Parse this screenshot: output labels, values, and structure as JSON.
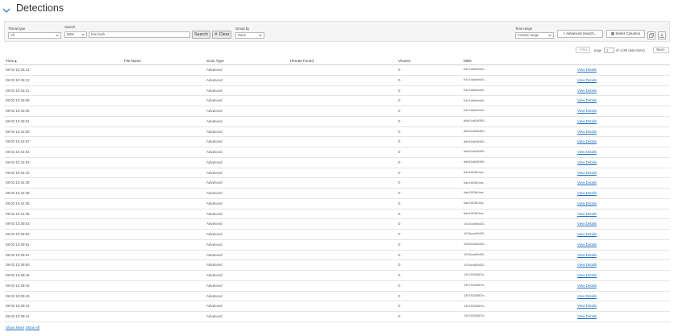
{
  "page": {
    "title": "Detections"
  },
  "filters": {
    "threat_type": {
      "label": "Threat type",
      "value": "All"
    },
    "search": {
      "label": "Search",
      "field": "MD5",
      "value": "has hash",
      "search_button": "Search",
      "clear_button": "Clear"
    },
    "group_by": {
      "label": "Group by",
      "value": "None"
    },
    "time_range": {
      "label": "Time range",
      "value": "Custom range"
    },
    "advanced_button": "Advanced Search...",
    "columns_button": "Select Columns"
  },
  "pagination": {
    "prev": "‹ Prev",
    "page_label": "page",
    "page": "1",
    "of_text": "of 4 (80 detections)",
    "next": "Next ›"
  },
  "table": {
    "headers": {
      "time": "Time",
      "file_name": "File Name",
      "scan_type": "Scan Type",
      "threats_found": "Threats Found",
      "viruses": "Viruses",
      "md5": "MD5"
    },
    "link_text": "View Details",
    "rows": [
      {
        "time": "08-03 10:45:12",
        "scan": "Advanced",
        "viruses": "0",
        "md5": "b3c7c6a6eb64..."
      },
      {
        "time": "08-03 10:45:12",
        "scan": "Advanced",
        "viruses": "0",
        "md5": "b3c7c6a6eb64..."
      },
      {
        "time": "08-03 10:45:11",
        "scan": "Advanced",
        "viruses": "0",
        "md5": "b3c7c6a6eb64..."
      },
      {
        "time": "08-03 10:45:09",
        "scan": "Advanced",
        "viruses": "0",
        "md5": "b3c7c6a6eb64..."
      },
      {
        "time": "08-03 10:45:06",
        "scan": "Advanced",
        "viruses": "0",
        "md5": "b3c7c6a6eb64..."
      },
      {
        "time": "08-03 10:45:01",
        "scan": "Advanced",
        "viruses": "0",
        "md5": "a5e51a65d359..."
      },
      {
        "time": "08-03 10:44:58",
        "scan": "Advanced",
        "viruses": "0",
        "md5": "a5e51a65d359..."
      },
      {
        "time": "08-03 10:44:57",
        "scan": "Advanced",
        "viruses": "0",
        "md5": "a5e51a65d359..."
      },
      {
        "time": "08-03 10:44:54",
        "scan": "Advanced",
        "viruses": "0",
        "md5": "a5e51a65d359..."
      },
      {
        "time": "08-03 10:44:53",
        "scan": "Advanced",
        "viruses": "0",
        "md5": "a5e51a65d359..."
      },
      {
        "time": "08-03 10:44:42",
        "scan": "Advanced",
        "viruses": "0",
        "md5": "5ae15f28e1ea..."
      },
      {
        "time": "08-03 10:44:39",
        "scan": "Advanced",
        "viruses": "0",
        "md5": "5ae15f28e1ea..."
      },
      {
        "time": "08-03 10:44:38",
        "scan": "Advanced",
        "viruses": "0",
        "md5": "5ae15f28e1ea..."
      },
      {
        "time": "08-03 10:44:35",
        "scan": "Advanced",
        "viruses": "0",
        "md5": "5ae15f28e1ea..."
      },
      {
        "time": "08-03 10:44:35",
        "scan": "Advanced",
        "viruses": "0",
        "md5": "5ae15f28e1ea..."
      },
      {
        "time": "08-03 10:39:53",
        "scan": "Advanced",
        "viruses": "0",
        "md5": "1015cca65d33..."
      },
      {
        "time": "08-03 10:39:52",
        "scan": "Advanced",
        "viruses": "0",
        "md5": "1015cca65d33..."
      },
      {
        "time": "08-03 10:39:51",
        "scan": "Advanced",
        "viruses": "0",
        "md5": "1015cca65d33..."
      },
      {
        "time": "08-03 10:39:51",
        "scan": "Advanced",
        "viruses": "0",
        "md5": "1015cca65d33..."
      },
      {
        "time": "08-03 10:39:50",
        "scan": "Advanced",
        "viruses": "0",
        "md5": "1015cca65d33..."
      },
      {
        "time": "08-03 10:39:46",
        "scan": "Advanced",
        "viruses": "0",
        "md5": "12b74528087e..."
      },
      {
        "time": "08-03 10:39:45",
        "scan": "Advanced",
        "viruses": "0",
        "md5": "12b74528087e..."
      },
      {
        "time": "08-03 10:39:45",
        "scan": "Advanced",
        "viruses": "0",
        "md5": "12b74528087e..."
      },
      {
        "time": "08-03 10:39:44",
        "scan": "Advanced",
        "viruses": "0",
        "md5": "12b74528087e..."
      },
      {
        "time": "08-03 10:39:44",
        "scan": "Advanced",
        "viruses": "0",
        "md5": "12b74528087e..."
      }
    ]
  },
  "footer": {
    "show_more": "Show More",
    "show_all": "Show All"
  },
  "colors": {
    "link": "#1a6fc2",
    "chevron": "#3a7fc4",
    "panel": "#f5f5f5"
  },
  "icons": {
    "header": "chevron-down-icon",
    "clear": "close-icon",
    "advanced": "search-icon",
    "columns": "columns-icon",
    "copy": "copy-icon",
    "export": "download-icon"
  }
}
